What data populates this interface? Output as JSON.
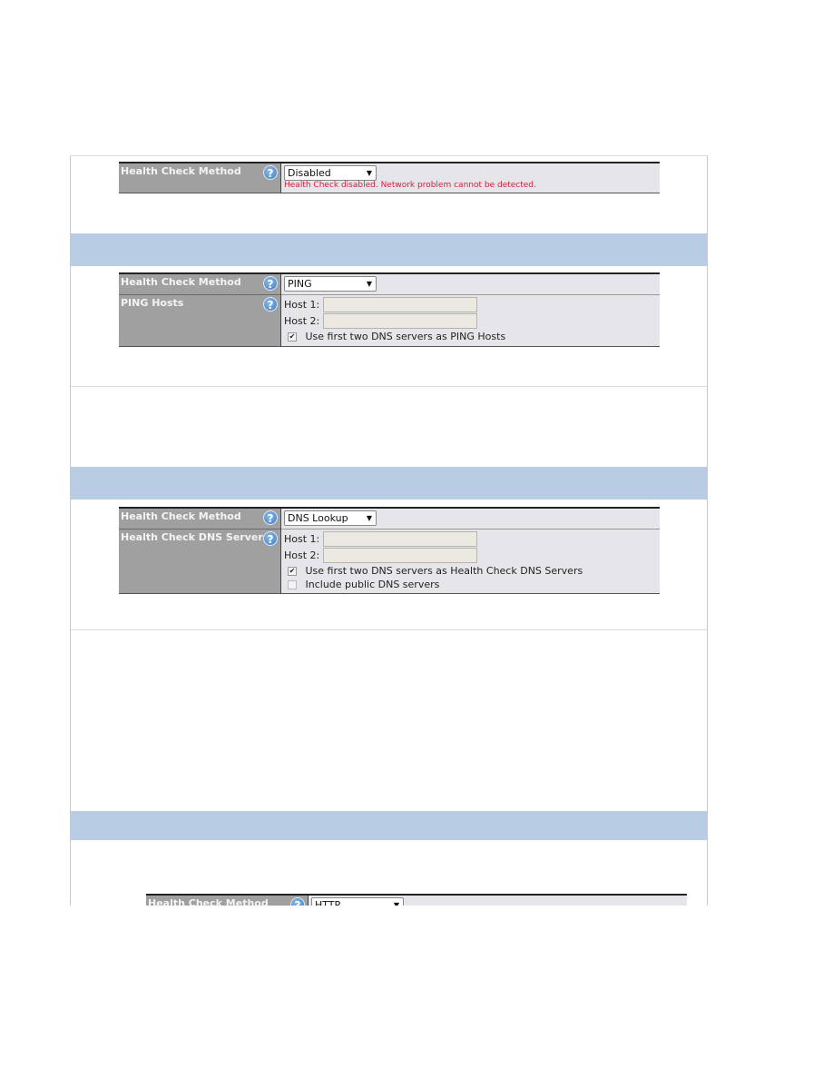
{
  "colors": {
    "section_band": "#b8cde4",
    "label_bg": "#a0a0a0",
    "value_bg": "#e6e6ea",
    "warning_text": "#d0213b",
    "help_icon": "#3f7fc4"
  },
  "panels": [
    {
      "method_label": "Health Check Method",
      "method_value": "Disabled",
      "warning": "Health Check disabled. Network problem cannot be detected."
    },
    {
      "method_label": "Health Check Method",
      "method_value": "PING",
      "hosts_label": "PING Hosts",
      "host1_label": "Host 1:",
      "host1_value": "",
      "host2_label": "Host 2:",
      "host2_value": "",
      "checkbox1": {
        "label": "Use first two DNS servers as PING Hosts",
        "checked": true
      }
    },
    {
      "method_label": "Health Check Method",
      "method_value": "DNS Lookup",
      "hosts_label": "Health Check DNS Servers",
      "host1_label": "Host 1:",
      "host1_value": "",
      "host2_label": "Host 2:",
      "host2_value": "",
      "checkbox1": {
        "label": "Use first two DNS servers as Health Check DNS Servers",
        "checked": true
      },
      "checkbox2": {
        "label": "Include public DNS servers",
        "checked": false
      }
    },
    {
      "method_label": "Health Check Method",
      "method_value": "HTTP"
    }
  ],
  "icons": {
    "help": "?",
    "dropdown": "▼",
    "check": "✔"
  }
}
